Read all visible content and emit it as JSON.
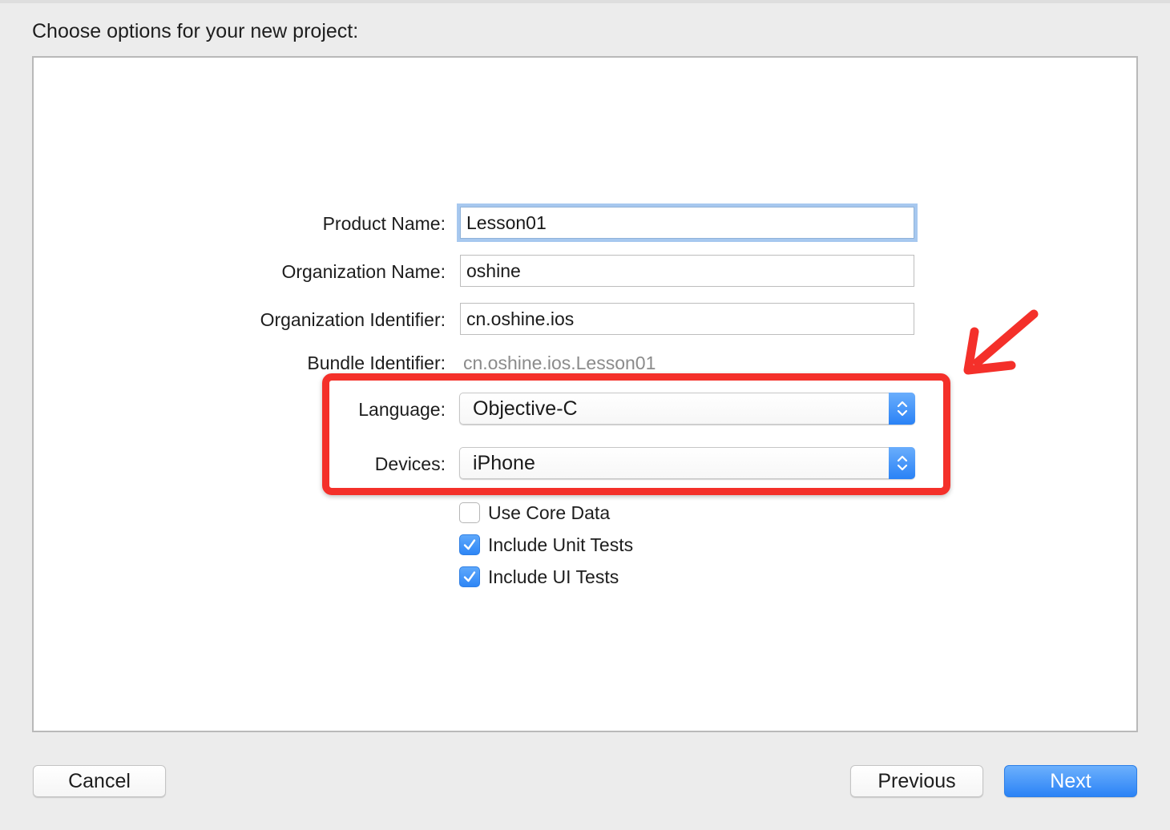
{
  "dialog": {
    "title": "Choose options for your new project:"
  },
  "form": {
    "product_name": {
      "label": "Product Name:",
      "value": "Lesson01"
    },
    "organization_name": {
      "label": "Organization Name:",
      "value": "oshine"
    },
    "organization_identifier": {
      "label": "Organization Identifier:",
      "value": "cn.oshine.ios"
    },
    "bundle_identifier": {
      "label": "Bundle Identifier:",
      "value": "cn.oshine.ios.Lesson01"
    },
    "language": {
      "label": "Language:",
      "value": "Objective-C"
    },
    "devices": {
      "label": "Devices:",
      "value": "iPhone"
    },
    "checkboxes": [
      {
        "label": "Use Core Data",
        "checked": false
      },
      {
        "label": "Include Unit Tests",
        "checked": true
      },
      {
        "label": "Include UI Tests",
        "checked": true
      }
    ]
  },
  "annotation": {
    "color": "#f4302a"
  },
  "buttons": {
    "cancel": "Cancel",
    "previous": "Previous",
    "next": "Next"
  },
  "colors": {
    "accent": "#2b83f6",
    "focus_ring": "#a7c8ef",
    "panel_background": "#ffffff",
    "window_background": "#ececec"
  },
  "icons": {
    "popup_stepper": "up-down-chevron-icon",
    "checkmark": "checkmark-icon",
    "annotation_arrow": "red-arrow-icon"
  }
}
